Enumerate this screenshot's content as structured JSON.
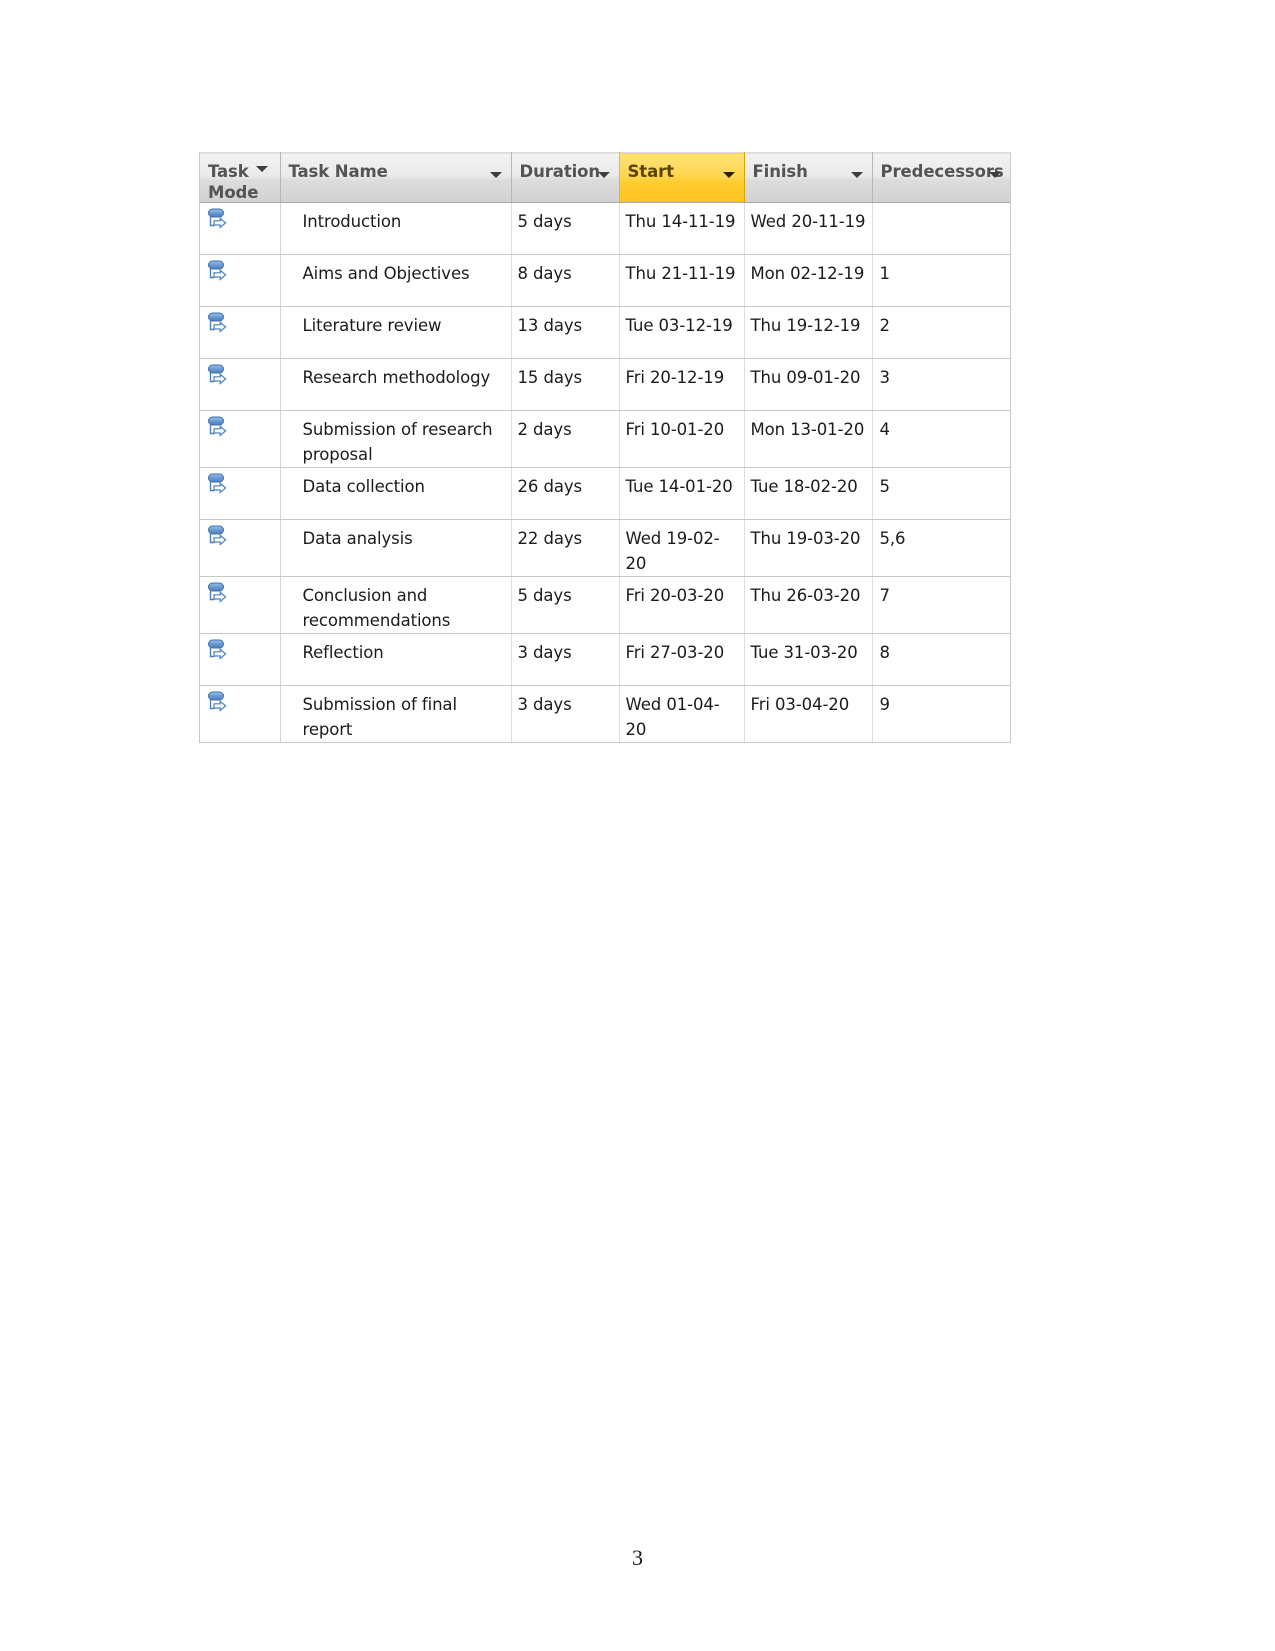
{
  "document": {
    "page_number": "3"
  },
  "grid": {
    "columns": [
      {
        "key": "task_mode",
        "label": "Task\nMode",
        "icon": "chevron-down-icon",
        "highlighted": false
      },
      {
        "key": "task_name",
        "label": "Task Name",
        "icon": "chevron-down-icon",
        "highlighted": false
      },
      {
        "key": "duration",
        "label": "Duration",
        "icon": "chevron-down-icon",
        "highlighted": false
      },
      {
        "key": "start",
        "label": "Start",
        "icon": "chevron-down-icon",
        "highlighted": true
      },
      {
        "key": "finish",
        "label": "Finish",
        "icon": "chevron-down-icon",
        "highlighted": false
      },
      {
        "key": "predecessors",
        "label": "Predecessors",
        "icon": "chevron-down-icon",
        "highlighted": false
      }
    ],
    "highlight_color": "#ffd64f",
    "header_color": "#e4e4e4",
    "row_icon": "manually-scheduled-task-icon",
    "rows": [
      {
        "task_mode": "manually-scheduled-task-icon",
        "task_name": "Introduction",
        "duration": "5 days",
        "start": "Thu 14-11-19",
        "finish": "Wed 20-11-19",
        "predecessors": ""
      },
      {
        "task_mode": "manually-scheduled-task-icon",
        "task_name": "Aims and Objectives",
        "duration": "8 days",
        "start": "Thu 21-11-19",
        "finish": "Mon 02-12-19",
        "predecessors": "1"
      },
      {
        "task_mode": "manually-scheduled-task-icon",
        "task_name": "Literature review",
        "duration": "13 days",
        "start": "Tue 03-12-19",
        "finish": "Thu 19-12-19",
        "predecessors": "2"
      },
      {
        "task_mode": "manually-scheduled-task-icon",
        "task_name": "Research methodology",
        "duration": "15 days",
        "start": "Fri 20-12-19",
        "finish": "Thu 09-01-20",
        "predecessors": "3"
      },
      {
        "task_mode": "manually-scheduled-task-icon",
        "task_name": "Submission of research proposal",
        "duration": "2 days",
        "start": "Fri 10-01-20",
        "finish": "Mon 13-01-20",
        "predecessors": "4"
      },
      {
        "task_mode": "manually-scheduled-task-icon",
        "task_name": "Data collection",
        "duration": "26 days",
        "start": "Tue 14-01-20",
        "finish": "Tue 18-02-20",
        "predecessors": "5"
      },
      {
        "task_mode": "manually-scheduled-task-icon",
        "task_name": "Data analysis",
        "duration": "22 days",
        "start": "Wed 19-02-20",
        "finish": "Thu 19-03-20",
        "predecessors": "5,6"
      },
      {
        "task_mode": "manually-scheduled-task-icon",
        "task_name": "Conclusion and recommendations",
        "duration": "5 days",
        "start": "Fri 20-03-20",
        "finish": "Thu 26-03-20",
        "predecessors": "7"
      },
      {
        "task_mode": "manually-scheduled-task-icon",
        "task_name": "Reflection",
        "duration": "3 days",
        "start": "Fri 27-03-20",
        "finish": "Tue 31-03-20",
        "predecessors": "8"
      },
      {
        "task_mode": "manually-scheduled-task-icon",
        "task_name": "Submission of final report",
        "duration": "3 days",
        "start": "Wed 01-04-20",
        "finish": "Fri 03-04-20",
        "predecessors": "9"
      }
    ]
  }
}
